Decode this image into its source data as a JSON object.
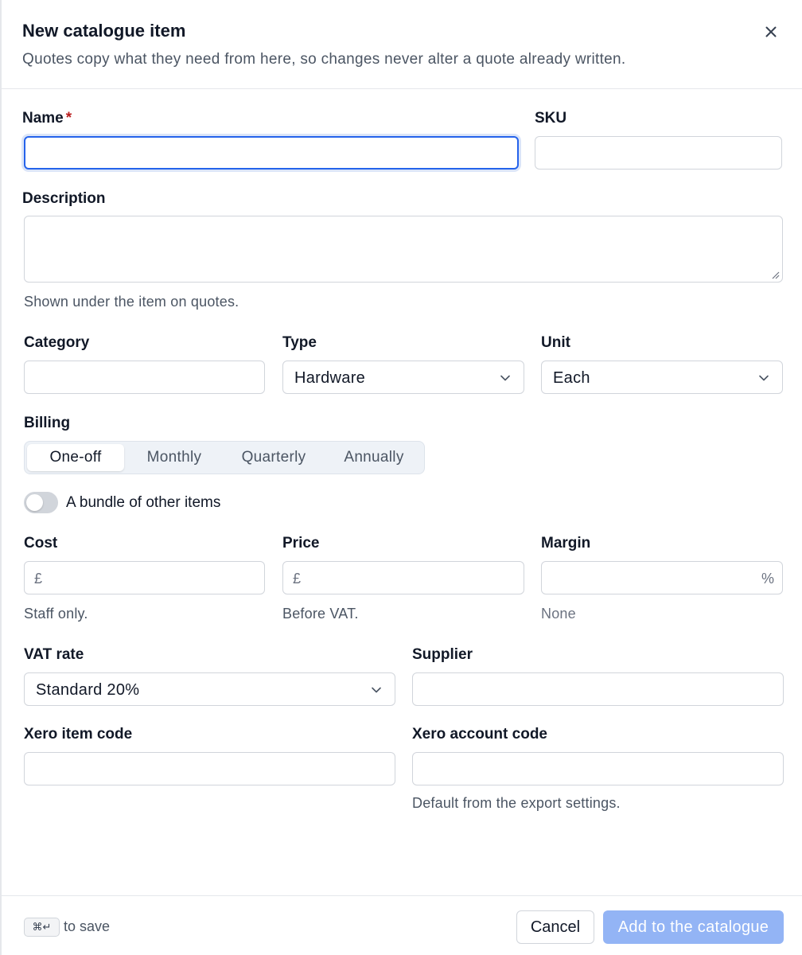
{
  "header": {
    "title": "New catalogue item",
    "subtitle": "Quotes copy what they need from here, so changes never alter a quote already written.",
    "close_icon": "×"
  },
  "form": {
    "name": {
      "label": "Name",
      "required_marker": "*",
      "value": ""
    },
    "sku": {
      "label": "SKU",
      "value": ""
    },
    "description": {
      "label": "Description",
      "value": "",
      "hint": "Shown under the item on quotes."
    },
    "category": {
      "label": "Category",
      "value": ""
    },
    "type": {
      "label": "Type",
      "value": "Hardware"
    },
    "unit": {
      "label": "Unit",
      "value": "Each"
    },
    "billing": {
      "label": "Billing",
      "options": [
        "One-off",
        "Monthly",
        "Quarterly",
        "Annually"
      ],
      "selected": "One-off"
    },
    "bundle": {
      "label": "A bundle of other items",
      "checked": false
    },
    "cost": {
      "label": "Cost",
      "prefix": "£",
      "value": "",
      "hint": "Staff only."
    },
    "price": {
      "label": "Price",
      "prefix": "£",
      "value": "",
      "hint": "Before VAT."
    },
    "margin": {
      "label": "Margin",
      "suffix": "%",
      "value": "",
      "hint": "None"
    },
    "vat_rate": {
      "label": "VAT rate",
      "value": "Standard 20%"
    },
    "supplier": {
      "label": "Supplier",
      "value": ""
    },
    "xero_item_code": {
      "label": "Xero item code",
      "value": ""
    },
    "xero_account_code": {
      "label": "Xero account code",
      "value": "",
      "hint": "Default from the export settings."
    }
  },
  "footer": {
    "shortcut_keys": "⌘↵",
    "shortcut_hint": "to save",
    "cancel_label": "Cancel",
    "submit_label": "Add to the catalogue"
  },
  "colors": {
    "accent": "#2563eb",
    "primary_disabled": "#93b4f5",
    "required": "#b91c1c"
  }
}
